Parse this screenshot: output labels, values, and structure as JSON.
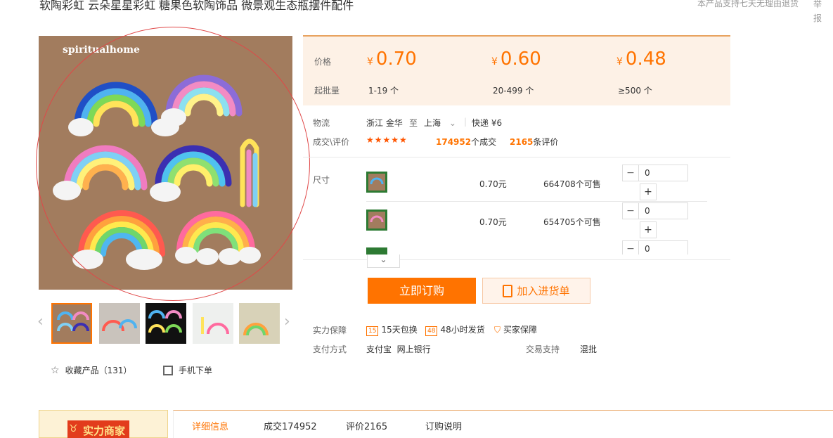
{
  "product": {
    "title": "软陶彩虹 云朵星星彩虹 糖果色软陶饰品 微景观生态瓶摆件配件",
    "return_notice": "本产品支持七天无理由退货",
    "report": "举报",
    "watermark": "spiritualhome"
  },
  "prices": {
    "label_price": "价格",
    "label_moq": "起批量",
    "currency": "¥",
    "tiers": [
      {
        "price": "0.70",
        "range": "1-19 个"
      },
      {
        "price": "0.60",
        "range": "20-499 个"
      },
      {
        "price": "0.48",
        "range": "≥500 个"
      }
    ]
  },
  "logistics": {
    "label": "物流",
    "from": "浙江 金华",
    "to_word": "至",
    "to": "上海",
    "shipping": "快递 ¥6"
  },
  "deals": {
    "label": "成交\\评价",
    "stars": "★★★★★",
    "deals_count": "174952",
    "deals_suffix": "个成交",
    "reviews_count": "2165",
    "reviews_suffix": "条评价"
  },
  "sku": {
    "label": "尺寸",
    "rows": [
      {
        "price": "0.70元",
        "stock": "664708个可售",
        "qty": "0"
      },
      {
        "price": "0.70元",
        "stock": "654705个可售",
        "qty": "0"
      },
      {
        "qty": "0"
      }
    ]
  },
  "actions": {
    "order": "立即订购",
    "cart": "加入进货单"
  },
  "guarantees": {
    "label": "实力保障",
    "items": [
      {
        "badge": "15",
        "text": "15天包换"
      },
      {
        "badge": "48",
        "text": "48小时发货"
      },
      {
        "badge": "",
        "text": "买家保障"
      }
    ]
  },
  "payment": {
    "label": "支付方式",
    "methods": "支付宝  网上银行",
    "trade_label": "交易支持",
    "trade_value": "混批"
  },
  "sidebar": {
    "favorite": "收藏产品（131）",
    "mobile": "手机下单"
  },
  "bottom": {
    "strength": "实力商家",
    "tabs": [
      "详细信息",
      "成交174952",
      "评价2165",
      "订购说明"
    ]
  },
  "colors": {
    "accent": "#ff7300",
    "price_bg": "#fdf1e6"
  }
}
